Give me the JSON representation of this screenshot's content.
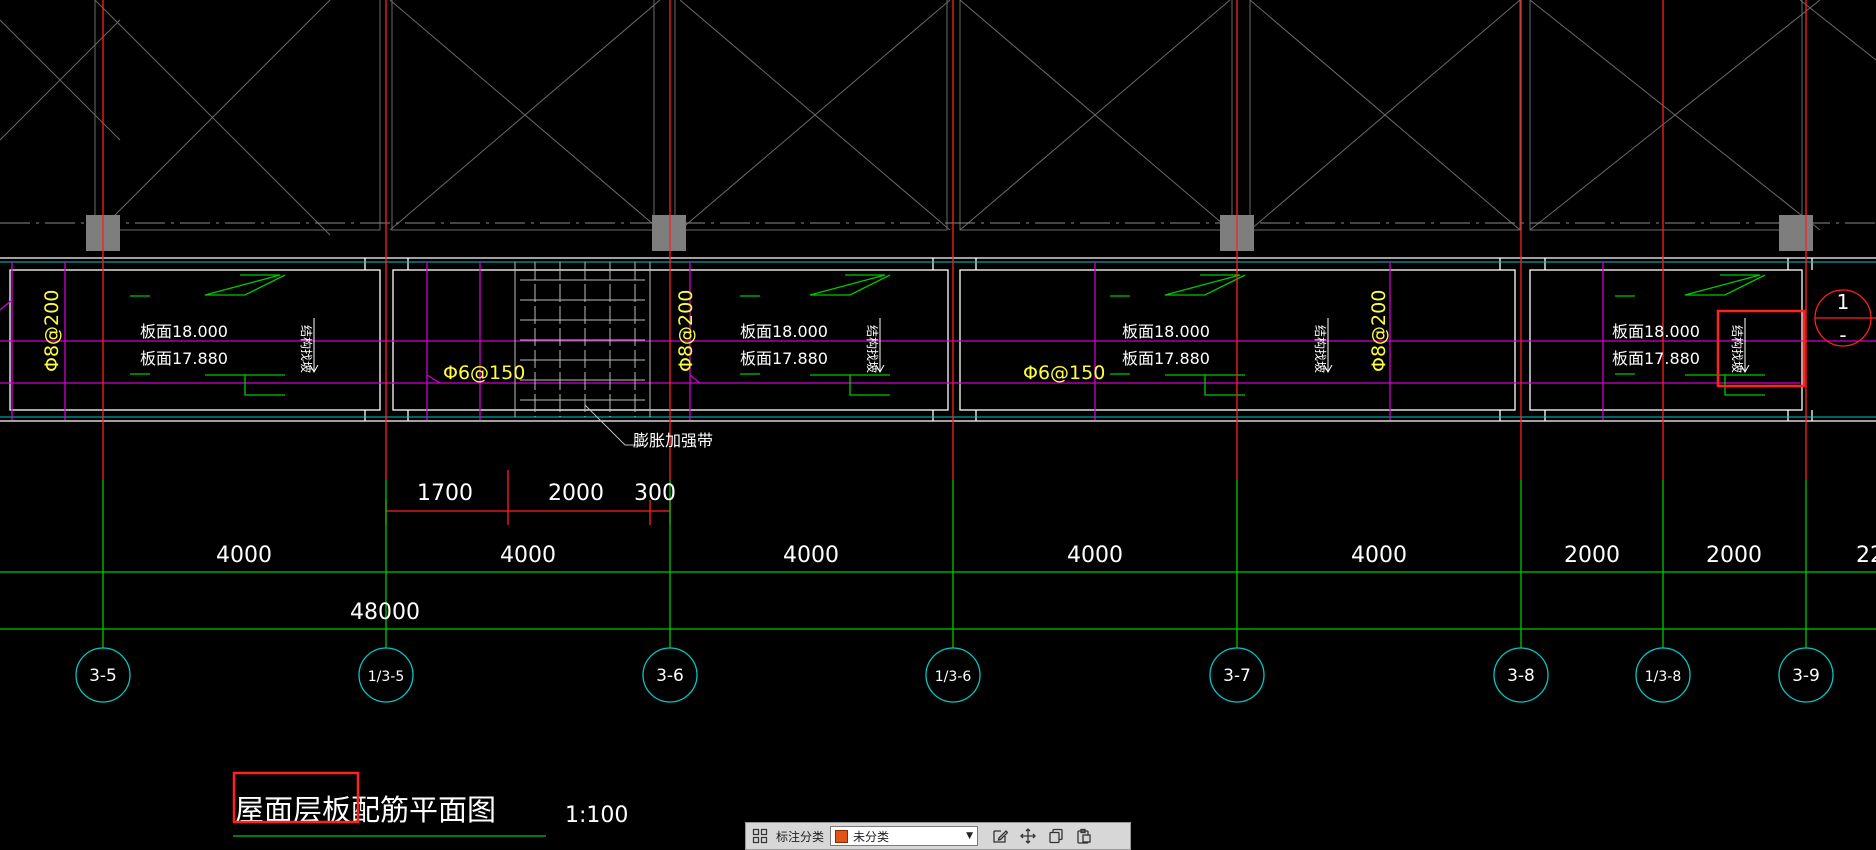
{
  "drawing": {
    "title": "屋面层板配筋平面图",
    "scale": "1:100",
    "rebar_labels": {
      "phi8_200": "Φ8@200",
      "phi6_150": "Φ6@150"
    },
    "slab_elev": {
      "top": "板面18.000",
      "low": "板面17.880"
    },
    "vertical_note": "结构找坡",
    "expansion_band": "膨胀加强带",
    "dims_small": [
      "1700",
      "2000",
      "300"
    ],
    "dims_bays": [
      "4000",
      "4000",
      "4000",
      "4000",
      "4000",
      "2000",
      "2000",
      "22"
    ],
    "dims_total": "48000",
    "axes": [
      "3-5",
      "1/3-5",
      "3-6",
      "1/3-6",
      "3-7",
      "3-8",
      "1/3-8",
      "3-9"
    ],
    "section_mark": {
      "top": "1",
      "bottom": "-"
    },
    "colors": {
      "background": "#000000",
      "grid": "#00c800",
      "axis_bubble": "#00c8c8",
      "center_line": "#ff2020",
      "slab_line": "#ffffff",
      "magenta": "#d000d0",
      "rebar_text": "#ffff40",
      "highlight": "#ff2020"
    }
  },
  "toolbar": {
    "grid_icon": "grid-icon",
    "category_label": "标注分类",
    "category_value": "未分类",
    "tools": [
      "edit-icon",
      "move-icon",
      "copy-icon",
      "paste-icon"
    ]
  }
}
